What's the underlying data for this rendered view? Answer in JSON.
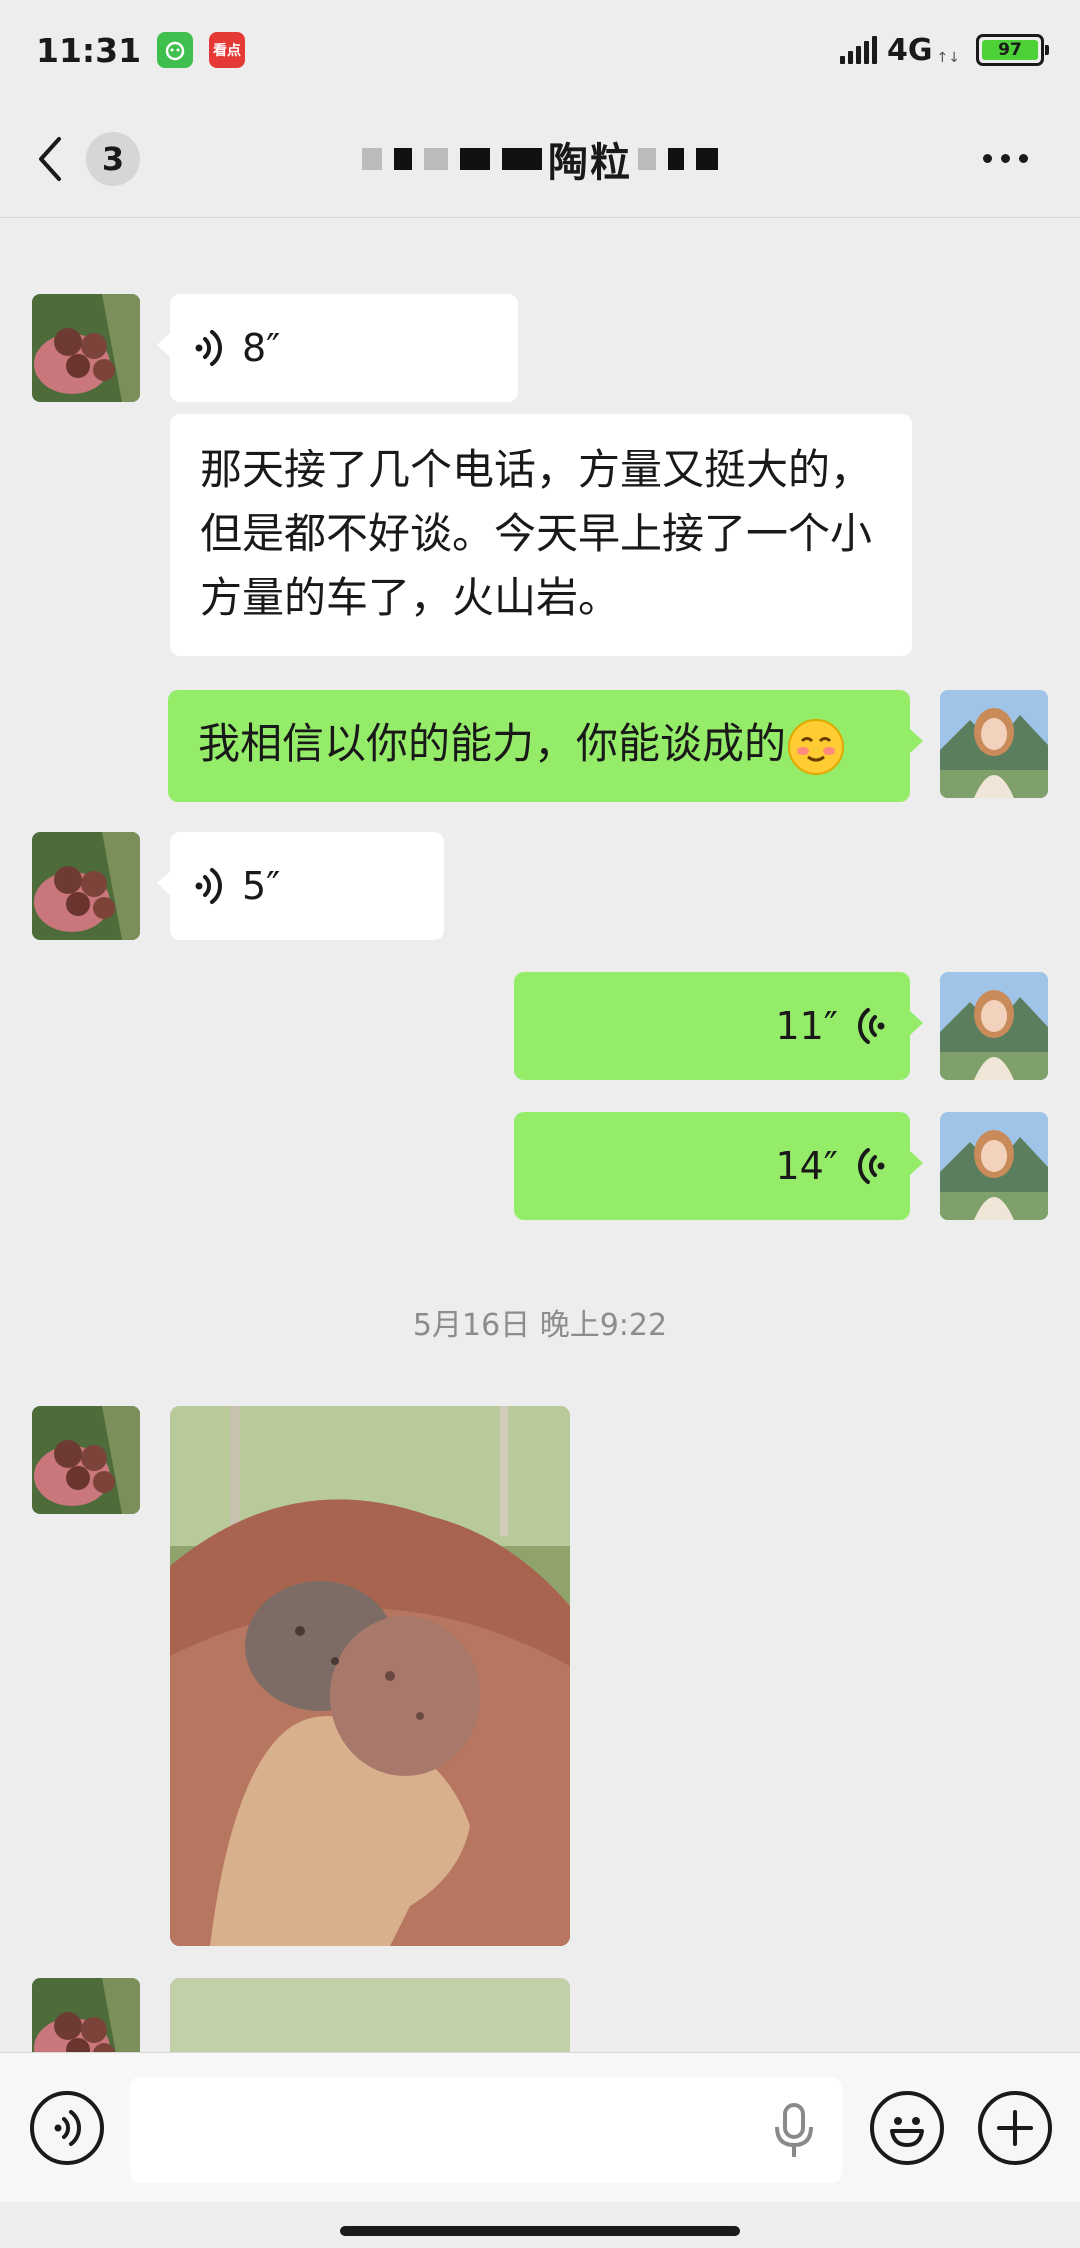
{
  "status_bar": {
    "time": "11:31",
    "app_badge_1": "",
    "app_badge_2": "看点",
    "network": "4G",
    "network_sub": "↑↓",
    "battery": "97"
  },
  "header": {
    "unread_count": "3",
    "title_visible": "陶粒"
  },
  "messages": {
    "m1_voice_duration": "8″",
    "m2_text": "那天接了几个电话，方量又挺大的，但是都不好谈。今天早上接了一个小方量的车了，火山岩。",
    "m3_text": "我相信以你的能力，你能谈成的",
    "m4_voice_duration": "5″",
    "m5_voice_duration": "11″",
    "m6_voice_duration": "14″"
  },
  "timestamp": "5月16日 晚上9:22",
  "input_bar": {
    "placeholder": ""
  },
  "colors": {
    "bubble_self": "#95ec69",
    "bubble_other": "#ffffff",
    "background": "#ededed"
  },
  "icons": [
    "back-icon",
    "more-icon",
    "voice-wave-icon",
    "mic-icon",
    "emoji-icon",
    "plus-icon",
    "voice-toggle-icon"
  ]
}
